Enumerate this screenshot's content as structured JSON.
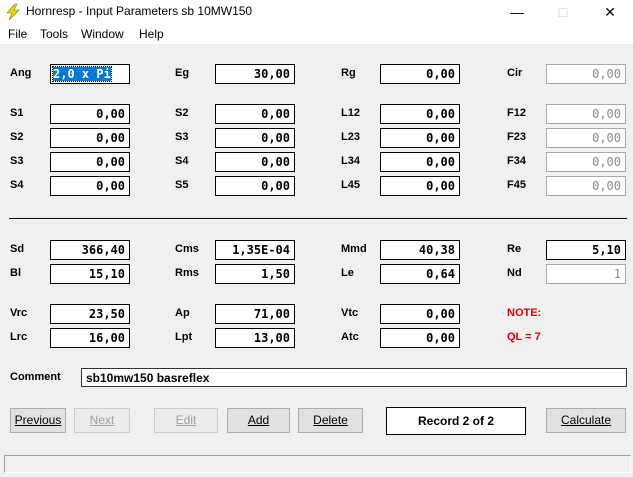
{
  "window": {
    "title": "Hornresp - Input Parameters   sb 10MW150"
  },
  "menu": [
    "File",
    "Tools",
    "Window",
    "Help"
  ],
  "params": {
    "Ang": "2,0 x Pi",
    "Eg": "30,00",
    "Rg": "0,00",
    "Cir": "0,00",
    "S1": "0,00",
    "S2": "0,00",
    "L12": "0,00",
    "F12": "0,00",
    "S2b": "0,00",
    "S3": "0,00",
    "L23": "0,00",
    "F23": "0,00",
    "S3b": "0,00",
    "S4": "0,00",
    "L34": "0,00",
    "F34": "0,00",
    "S4b": "0,00",
    "S5": "0,00",
    "L45": "0,00",
    "F45": "0,00",
    "Sd": "366,40",
    "Cms": "1,35E-04",
    "Mmd": "40,38",
    "Re": "5,10",
    "Bl": "15,10",
    "Rms": "1,50",
    "Le": "0,64",
    "Nd": "1",
    "Vrc": "23,50",
    "Ap": "71,00",
    "Vtc": "0,00",
    "Lrc": "16,00",
    "Lpt": "13,00",
    "Atc": "0,00"
  },
  "labels": {
    "Ang": "Ang",
    "Eg": "Eg",
    "Rg": "Rg",
    "Cir": "Cir",
    "S1": "S1",
    "S2": "S2",
    "L12": "L12",
    "F12": "F12",
    "S3": "S3",
    "L23": "L23",
    "F23": "F23",
    "S4": "S4",
    "L34": "L34",
    "F34": "F34",
    "S5": "S5",
    "L45": "L45",
    "F45": "F45",
    "Sd": "Sd",
    "Cms": "Cms",
    "Mmd": "Mmd",
    "Re": "Re",
    "Bl": "Bl",
    "Rms": "Rms",
    "Le": "Le",
    "Nd": "Nd",
    "Vrc": "Vrc",
    "Ap": "Ap",
    "Vtc": "Vtc",
    "Lrc": "Lrc",
    "Lpt": "Lpt",
    "Atc": "Atc",
    "note": "NOTE:",
    "ql": "QL = 7",
    "comment": "Comment"
  },
  "comment_value": "sb10mw150 basreflex",
  "buttons": {
    "previous": "Previous",
    "next": "Next",
    "edit": "Edit",
    "add": "Add",
    "delete": "Delete",
    "calculate": "Calculate"
  },
  "record": "Record 2 of 2"
}
